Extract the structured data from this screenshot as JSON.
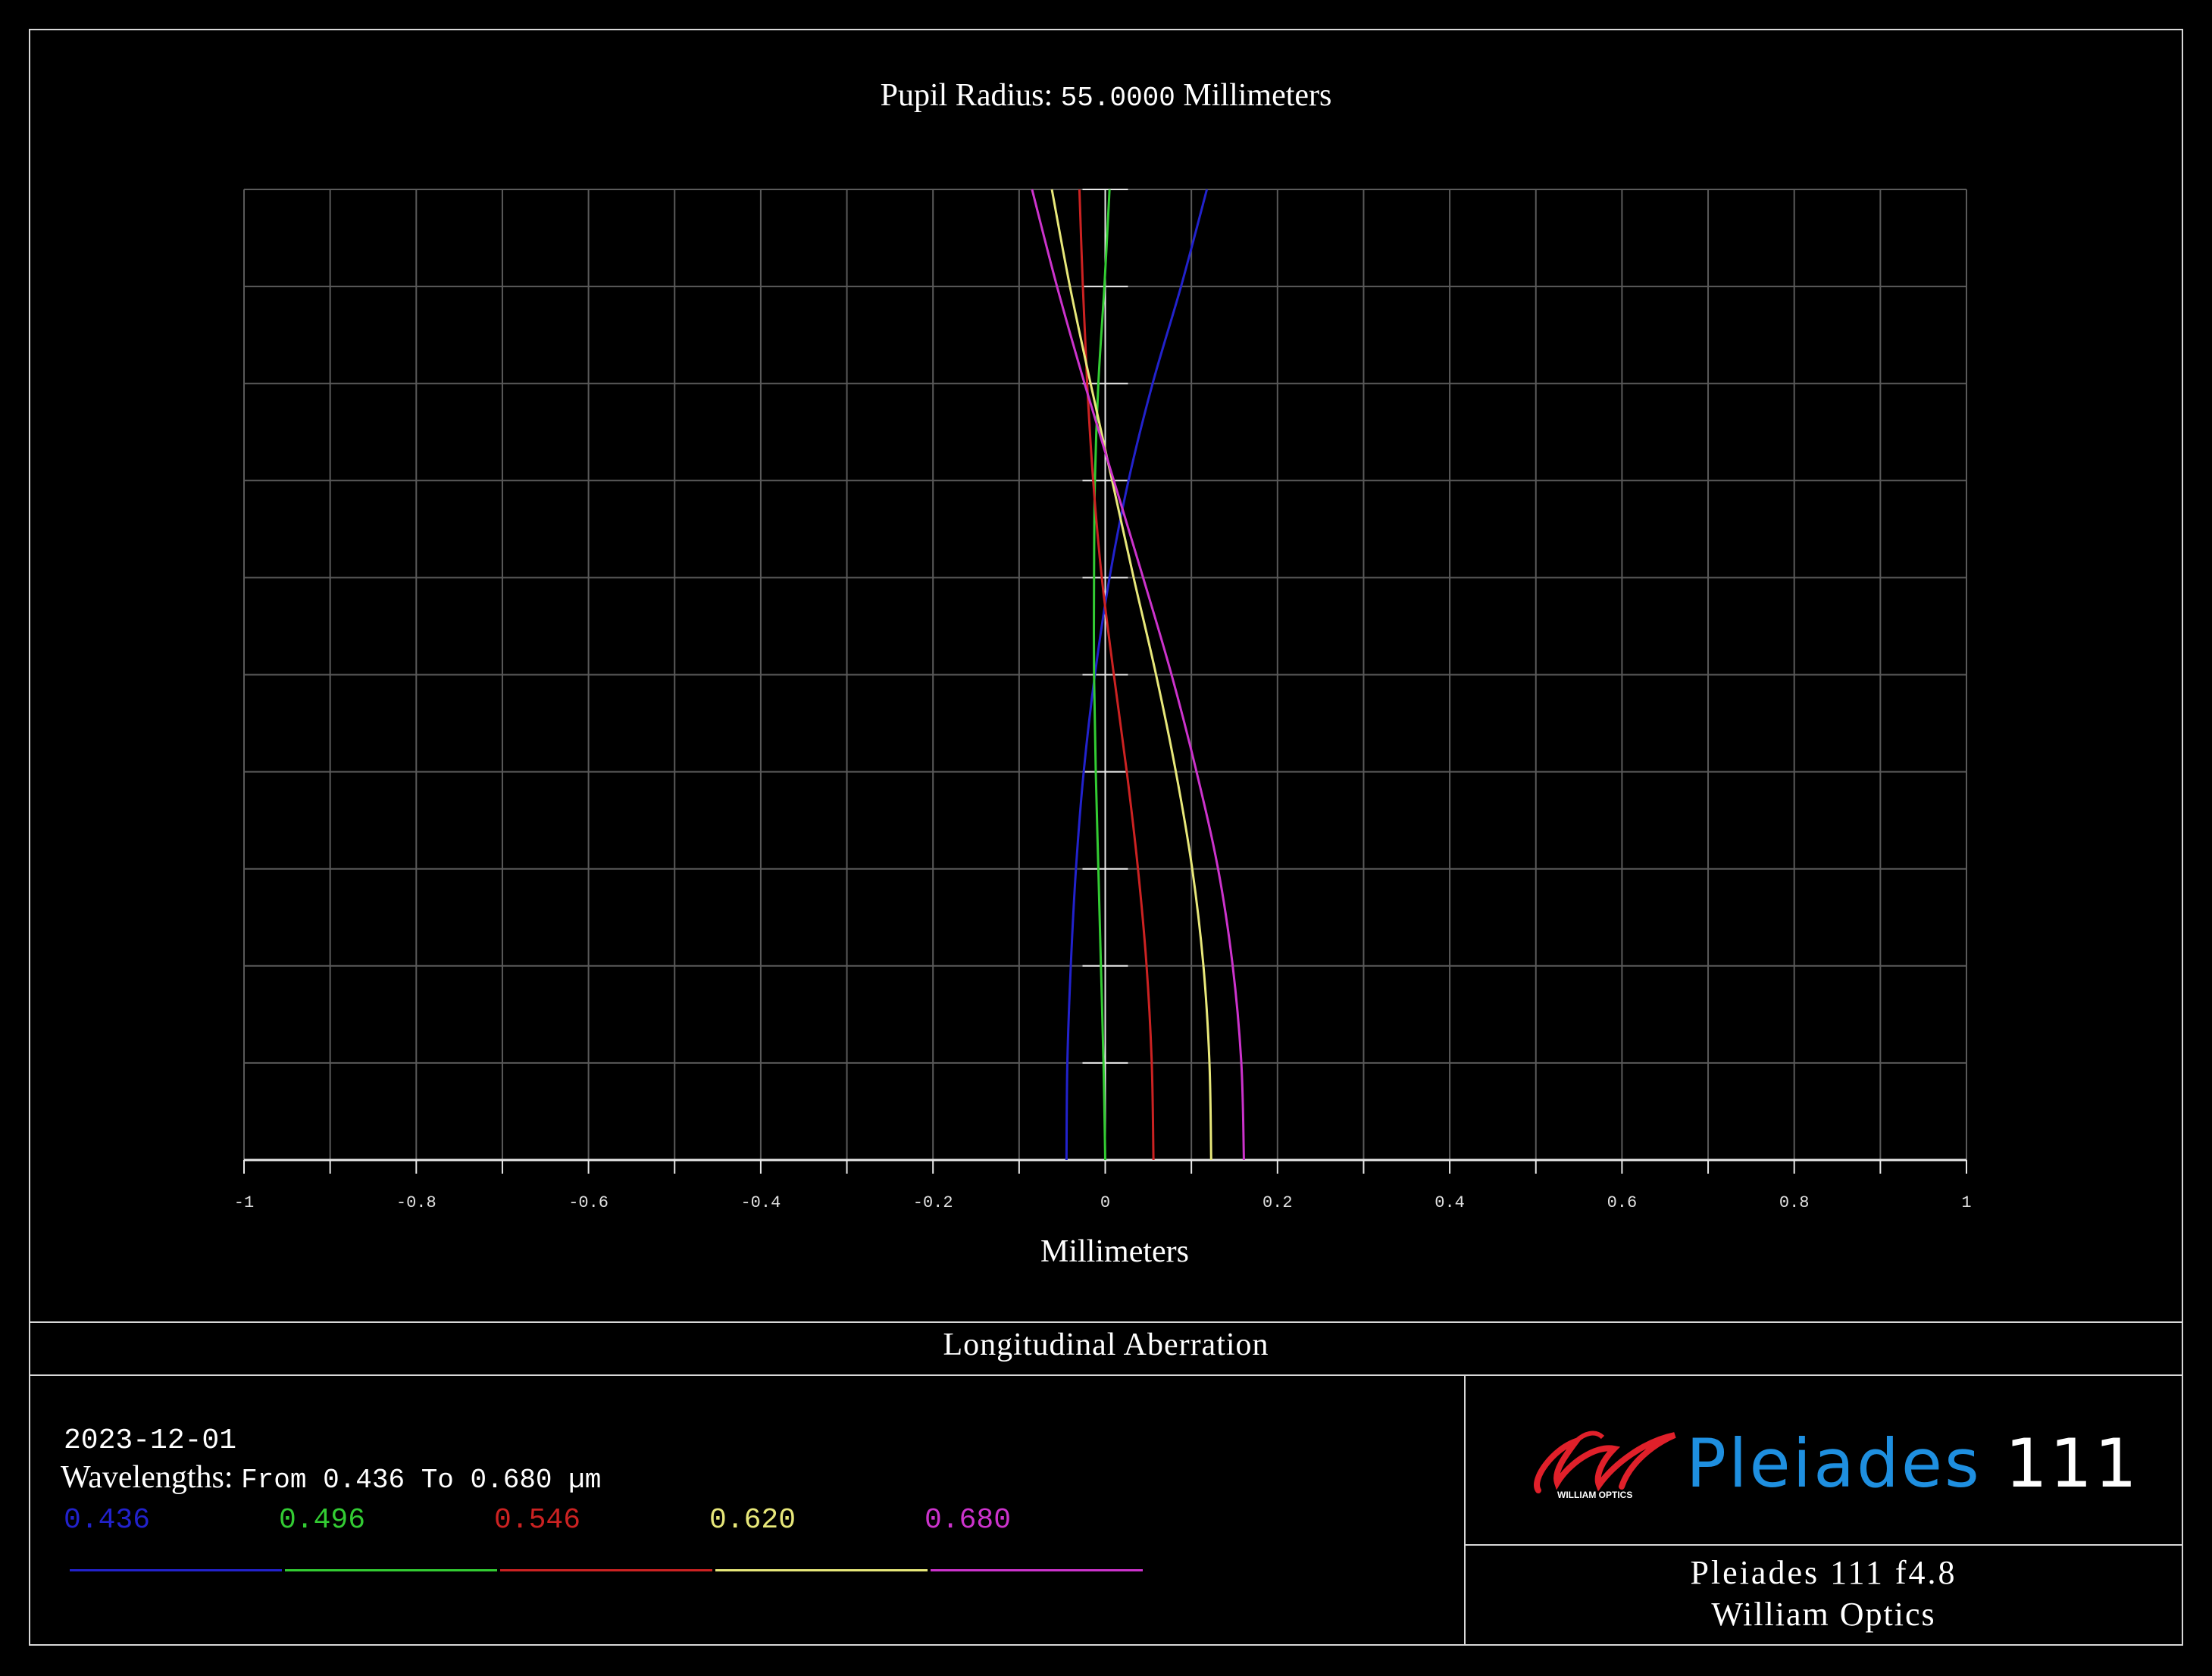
{
  "header": {
    "pupil_label": "Pupil Radius:",
    "pupil_value": "55.0000",
    "pupil_unit": "Millimeters"
  },
  "chart_data": {
    "type": "line",
    "title": "Pupil Radius: 55.0000 Millimeters",
    "xlabel": "Millimeters",
    "ylabel": "",
    "xlim": [
      -1,
      1
    ],
    "ylim": [
      0,
      1
    ],
    "grid": true,
    "x_tick_labels": [
      "-1",
      "-0.8",
      "-0.6",
      "-0.4",
      "-0.2",
      "0",
      "0.2",
      "0.4",
      "0.6",
      "0.8",
      "1"
    ],
    "series": [
      {
        "name": "0.436",
        "color": "#2222cc",
        "points": [
          [
            -0.045,
            0
          ],
          [
            -0.044,
            0.1
          ],
          [
            -0.04,
            0.2
          ],
          [
            -0.034,
            0.3
          ],
          [
            -0.025,
            0.4
          ],
          [
            -0.012,
            0.5
          ],
          [
            0.005,
            0.6
          ],
          [
            0.027,
            0.7
          ],
          [
            0.055,
            0.8
          ],
          [
            0.088,
            0.9
          ],
          [
            0.118,
            1.0
          ]
        ]
      },
      {
        "name": "0.496",
        "color": "#33cc33",
        "points": [
          [
            0,
            0
          ],
          [
            -0.002,
            0.1
          ],
          [
            -0.005,
            0.2
          ],
          [
            -0.008,
            0.3
          ],
          [
            -0.011,
            0.4
          ],
          [
            -0.013,
            0.5
          ],
          [
            -0.013,
            0.6
          ],
          [
            -0.012,
            0.7
          ],
          [
            -0.008,
            0.8
          ],
          [
            -0.001,
            0.9
          ],
          [
            0.005,
            1.0
          ]
        ]
      },
      {
        "name": "0.546",
        "color": "#cc2222",
        "points": [
          [
            0.056,
            0
          ],
          [
            0.054,
            0.1
          ],
          [
            0.048,
            0.2
          ],
          [
            0.038,
            0.3
          ],
          [
            0.025,
            0.4
          ],
          [
            0.01,
            0.5
          ],
          [
            -0.004,
            0.6
          ],
          [
            -0.014,
            0.7
          ],
          [
            -0.021,
            0.8
          ],
          [
            -0.026,
            0.9
          ],
          [
            -0.03,
            1.0
          ]
        ]
      },
      {
        "name": "0.620",
        "color": "#e8e87a",
        "points": [
          [
            0.123,
            0
          ],
          [
            0.121,
            0.1
          ],
          [
            0.114,
            0.2
          ],
          [
            0.101,
            0.3
          ],
          [
            0.082,
            0.4
          ],
          [
            0.059,
            0.5
          ],
          [
            0.033,
            0.6
          ],
          [
            0.008,
            0.7
          ],
          [
            -0.017,
            0.8
          ],
          [
            -0.041,
            0.9
          ],
          [
            -0.062,
            1.0
          ]
        ]
      },
      {
        "name": "0.680",
        "color": "#cc33cc",
        "points": [
          [
            0.161,
            0
          ],
          [
            0.158,
            0.1
          ],
          [
            0.148,
            0.2
          ],
          [
            0.131,
            0.3
          ],
          [
            0.106,
            0.4
          ],
          [
            0.077,
            0.5
          ],
          [
            0.044,
            0.6
          ],
          [
            0.01,
            0.7
          ],
          [
            -0.024,
            0.8
          ],
          [
            -0.056,
            0.9
          ],
          [
            -0.085,
            1.0
          ]
        ]
      }
    ]
  },
  "panel": {
    "title": "Longitudinal Aberration",
    "date": "2023-12-01",
    "wavelengths_label": "Wavelengths:",
    "wavelengths_range": "From 0.436 To 0.680 µm",
    "legend": [
      {
        "label": "0.436",
        "color": "#2222cc"
      },
      {
        "label": "0.496",
        "color": "#33cc33"
      },
      {
        "label": "0.546",
        "color": "#cc2222"
      },
      {
        "label": "0.620",
        "color": "#e8e87a"
      },
      {
        "label": "0.680",
        "color": "#cc33cc"
      }
    ]
  },
  "logo": {
    "small_text": "WILLIAM OPTICS",
    "brand_blue": "Pleiades",
    "brand_white": "111",
    "blue_color": "#1e8fe0",
    "red_color": "#e0202a"
  },
  "info": {
    "title": "Pleiades 111 f4.8",
    "company": "William Optics"
  }
}
